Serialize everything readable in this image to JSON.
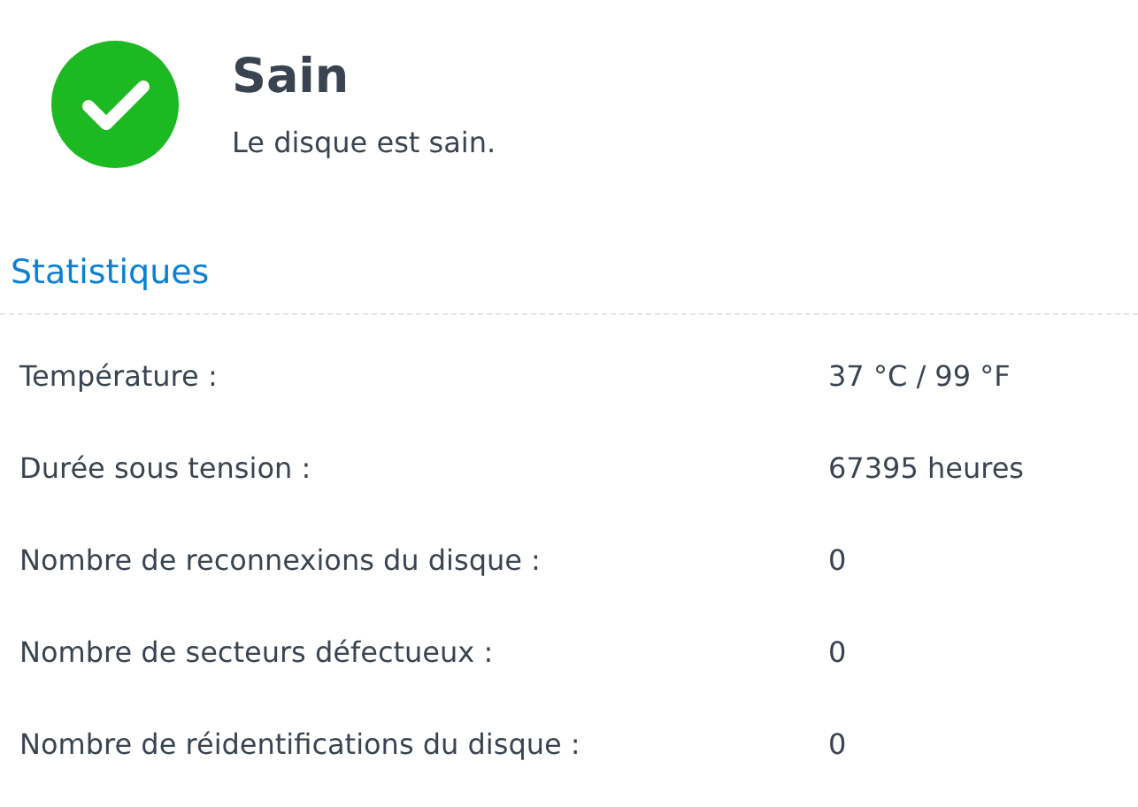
{
  "status": {
    "kind": "healthy",
    "title": "Sain",
    "message": "Le disque est sain."
  },
  "section": {
    "title": "Statistiques"
  },
  "stats": [
    {
      "label": "Température :",
      "value": "37 °C / 99 °F"
    },
    {
      "label": "Durée sous tension :",
      "value": "67395 heures"
    },
    {
      "label": "Nombre de reconnexions du disque :",
      "value": "0"
    },
    {
      "label": "Nombre de secteurs défectueux :",
      "value": "0"
    },
    {
      "label": "Nombre de réidentifications du disque :",
      "value": "0"
    }
  ]
}
